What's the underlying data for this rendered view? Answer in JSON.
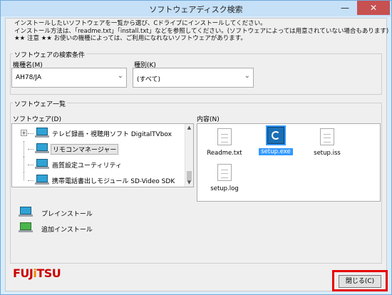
{
  "window": {
    "title": "ソフトウェアディスク検索",
    "minimize_symbol": "—",
    "close_symbol": "✕"
  },
  "intro": {
    "line1": "インストールしたいソフトウェアを一覧から選び、Cドライブにインストールしてください。",
    "line2": "インストール方法は、「readme.txt」「install.txt」などを参照してください。(ソフトウェアによっては用意されていない場合もあります)",
    "line3": "★★ 注意 ★★ お使いの機種によっては、ご利用になれないソフトウェアがあります。"
  },
  "search": {
    "group_label": "ソフトウェアの検索条件",
    "model_label": "機種名(M)",
    "model_value": "AH78/JA",
    "category_label": "種別(K)",
    "category_value": "(すべて)",
    "arrow": "⌄"
  },
  "list": {
    "group_label": "ソフトウェア一覧",
    "software_label": "ソフトウェア(D)",
    "content_label": "内容(N)",
    "items": [
      {
        "label": "テレビ録画・視聴用ソフト DigitalTVbox",
        "expander": "+"
      },
      {
        "label": "リモコンマネージャー"
      },
      {
        "label": "画質設定ユーティリティ"
      },
      {
        "label": "携帯電話書出しモジュール SD-Video SDK"
      }
    ],
    "files": [
      {
        "name": "Readme.txt"
      },
      {
        "name": "setup.exe"
      },
      {
        "name": "setup.iss"
      },
      {
        "name": "setup.log"
      }
    ],
    "scroll_up": "▲",
    "scroll_down": "▼"
  },
  "legend": {
    "preinstall": "プレインストール",
    "additional": "追加インストール"
  },
  "footer": {
    "logo_text_part1": "FUJ",
    "logo_accent": "i",
    "logo_text_part2": "TSU",
    "close_label": "閉じる(C)"
  },
  "colors": {
    "preinstall_icon": "#2fa3d6",
    "additional_icon": "#4cb54c",
    "highlight": "#e60000",
    "logo": "#cc0000"
  }
}
